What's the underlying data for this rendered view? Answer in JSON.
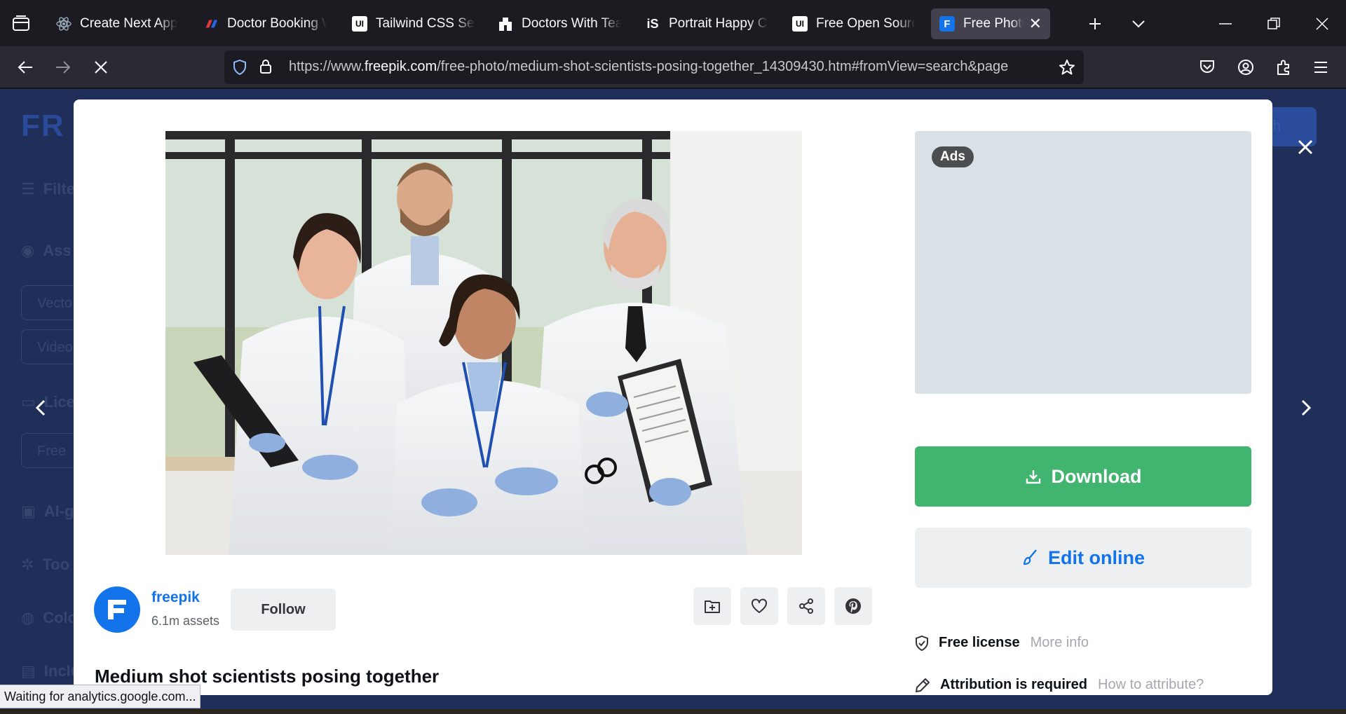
{
  "browser": {
    "tabs": [
      {
        "title": "Create Next App",
        "icon": "react-icon"
      },
      {
        "title": "Doctor Booking W",
        "icon": "doctor-booking-icon"
      },
      {
        "title": "Tailwind CSS Secti",
        "icon": "ui-icon"
      },
      {
        "title": "Doctors With Tean",
        "icon": "doctors-icon"
      },
      {
        "title": "Portrait Happy Co",
        "icon": "istock-icon"
      },
      {
        "title": "Free Open Source",
        "icon": "ui-icon"
      },
      {
        "title": "Free Photo | Me",
        "icon": "freepik-icon",
        "active": true
      }
    ],
    "url_prefix": "https://www.",
    "url_domain": "freepik.com",
    "url_path": "/free-photo/medium-shot-scientists-posing-together_14309430.htm#fromView=search&page",
    "status": "Waiting for analytics.google.com..."
  },
  "background_page": {
    "logo": "FR",
    "search_label": "arch",
    "sidebar": [
      "Filte",
      "Ass",
      "Lice",
      "AI-g",
      "Too",
      "Colo",
      "Inclu"
    ],
    "pills": [
      "Vecto",
      "Video",
      "Free"
    ]
  },
  "modal": {
    "ads_label": "Ads",
    "download_label": "Download",
    "edit_label": "Edit online",
    "author": {
      "name": "freepik",
      "assets": "6.1m assets",
      "follow_label": "Follow"
    },
    "title": "Medium shot scientists posing together",
    "license": {
      "label": "Free license",
      "link": "More info"
    },
    "attribution": {
      "label": "Attribution is required",
      "link": "How to attribute?"
    }
  },
  "colors": {
    "download": "#41b470",
    "brand_blue": "#1273eb",
    "overlay": "#1f2f5a"
  }
}
